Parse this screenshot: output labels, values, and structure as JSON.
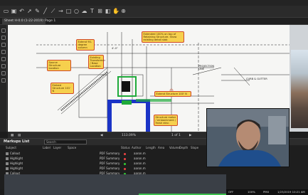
{
  "app": {
    "file_tab": "Sheet H-0.0 (1-22-2019)",
    "page_label": "Page 1",
    "sheet_tab": "Sheet H-0.0 (1-22-2019)"
  },
  "toolbar": {
    "icons": [
      "folder-icon",
      "save-icon",
      "undo-icon",
      "pointer-icon",
      "pen-icon",
      "line-icon",
      "polyline-icon",
      "arrow-icon",
      "rect-icon",
      "ellipse-icon",
      "cloud-icon",
      "text-icon",
      "measure-icon",
      "stamp-icon",
      "hand-icon",
      "zoom-icon"
    ]
  },
  "drawing": {
    "labels": {
      "projection_line": "PROJECTION LINE",
      "arrow_note": "CURB & GUTTER",
      "dim": "4'-0\""
    },
    "callouts": [
      "Extend 90-degree column",
      "Source Structure location",
      "Embed Structure 101' N",
      "Existing Transformer / Base Location",
      "Extended 100% on top of Retaining Structure. Show existing detail slab",
      "Extend Structure 100' N",
      "Structure meter / embankment / finish elev."
    ]
  },
  "viewbar": {
    "zoom": "113.09%",
    "page": "1 of 1"
  },
  "markups": {
    "title": "Markups List",
    "search_placeholder": "Search",
    "columns": [
      "Subject",
      "Label",
      "Layer",
      "Space",
      "Status",
      "Author",
      "Length",
      "Area",
      "Volume",
      "Depth",
      "Slope"
    ],
    "tree": [
      "Callout",
      "Highlight",
      "Highlight",
      "Highlight",
      "Callout"
    ],
    "rows": [
      {
        "subject": "PDF Summary",
        "author": "aaron.m",
        "dot": "#e44"
      },
      {
        "subject": "PDF Summary",
        "author": "aaron.m",
        "dot": "#e44"
      },
      {
        "subject": "PDF Summary",
        "author": "aaron.m",
        "dot": "#3c3"
      },
      {
        "subject": "PDF Summary",
        "author": "aaron.m",
        "dot": "#e44"
      },
      {
        "subject": "PDF Summary",
        "author": "aaron.m",
        "dot": "#3c3"
      }
    ]
  },
  "taskbar": {
    "items": [
      "OFF",
      "100%",
      "PMX",
      "1/23/2019 10:21 AM"
    ]
  },
  "colors": {
    "callout_fill": "#f6d04d",
    "callout_border": "#d04a2a",
    "highlight_green": "#1faa3a",
    "highlight_blue": "#1b34c6"
  }
}
